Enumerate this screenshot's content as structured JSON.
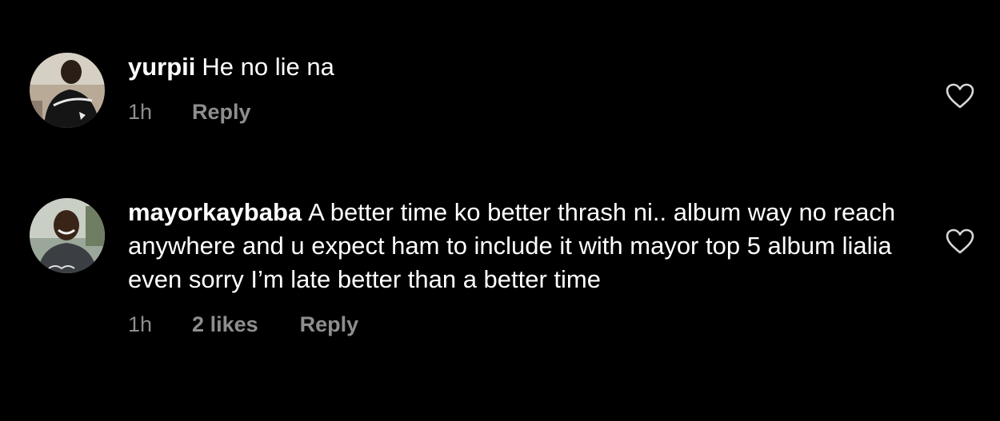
{
  "comments": [
    {
      "username": "yurpii",
      "text": "He no lie na",
      "time": "1h",
      "likes": "",
      "reply_label": "Reply",
      "avatar_icon": "user-avatar-shirt-print",
      "like_icon": "heart-outline-icon"
    },
    {
      "username": "mayorkaybaba",
      "text": "A better time ko better thrash ni.. album way no reach anywhere and u expect ham to include it with mayor top 5 album lialia even sorry I’m late better than a better time",
      "time": "1h",
      "likes": "2 likes",
      "reply_label": "Reply",
      "avatar_icon": "user-avatar-smiling",
      "like_icon": "heart-outline-icon"
    }
  ],
  "colors": {
    "background": "#000000",
    "text": "#ffffff",
    "meta": "#8e8e8e",
    "icon": "#d8d8d8"
  }
}
